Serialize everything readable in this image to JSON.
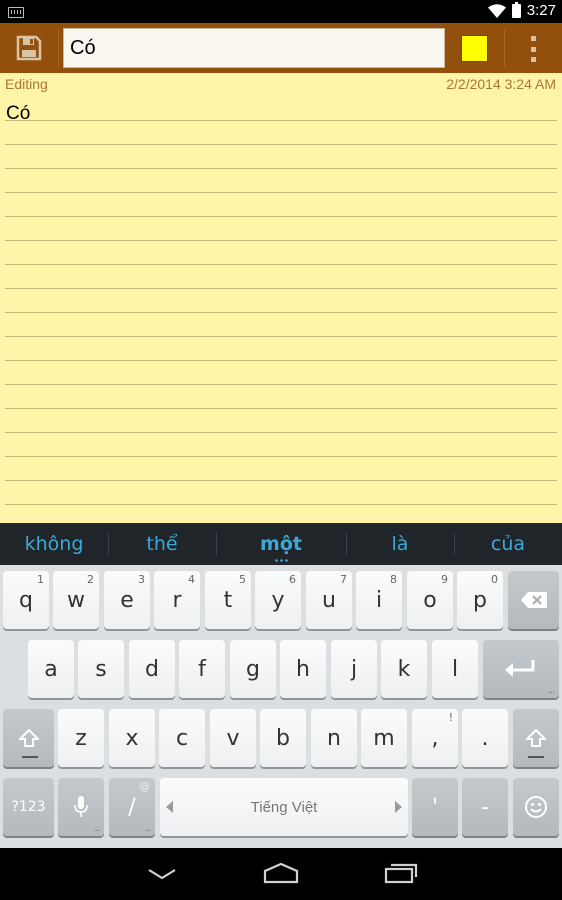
{
  "status_bar": {
    "time": "3:27"
  },
  "toolbar": {
    "title_value": "Có",
    "color": "#ffff00"
  },
  "note": {
    "status": "Editing",
    "date": "2/2/2014 3:24 AM",
    "body": "Có"
  },
  "suggestions": [
    {
      "text": "không",
      "bold": false
    },
    {
      "text": "thể",
      "bold": false
    },
    {
      "text": "một",
      "bold": true
    },
    {
      "text": "là",
      "bold": false
    },
    {
      "text": "của",
      "bold": false
    }
  ],
  "keyboard": {
    "row1": [
      {
        "label": "q",
        "hint": "1"
      },
      {
        "label": "w",
        "hint": "2"
      },
      {
        "label": "e",
        "hint": "3"
      },
      {
        "label": "r",
        "hint": "4"
      },
      {
        "label": "t",
        "hint": "5"
      },
      {
        "label": "y",
        "hint": "6"
      },
      {
        "label": "u",
        "hint": "7"
      },
      {
        "label": "i",
        "hint": "8"
      },
      {
        "label": "o",
        "hint": "9"
      },
      {
        "label": "p",
        "hint": "0"
      }
    ],
    "row2": [
      "a",
      "s",
      "d",
      "f",
      "g",
      "h",
      "j",
      "k",
      "l"
    ],
    "row3": [
      "z",
      "x",
      "c",
      "v",
      "b",
      "n",
      "m",
      ",",
      "."
    ],
    "symbols_label": "?123",
    "slash_label": "/",
    "slash_hint": "@",
    "space_label": "Tiếng Việt",
    "apostrophe_label": "'",
    "dash_label": "-",
    "more_hint": "...",
    "comma_hint": "!"
  }
}
